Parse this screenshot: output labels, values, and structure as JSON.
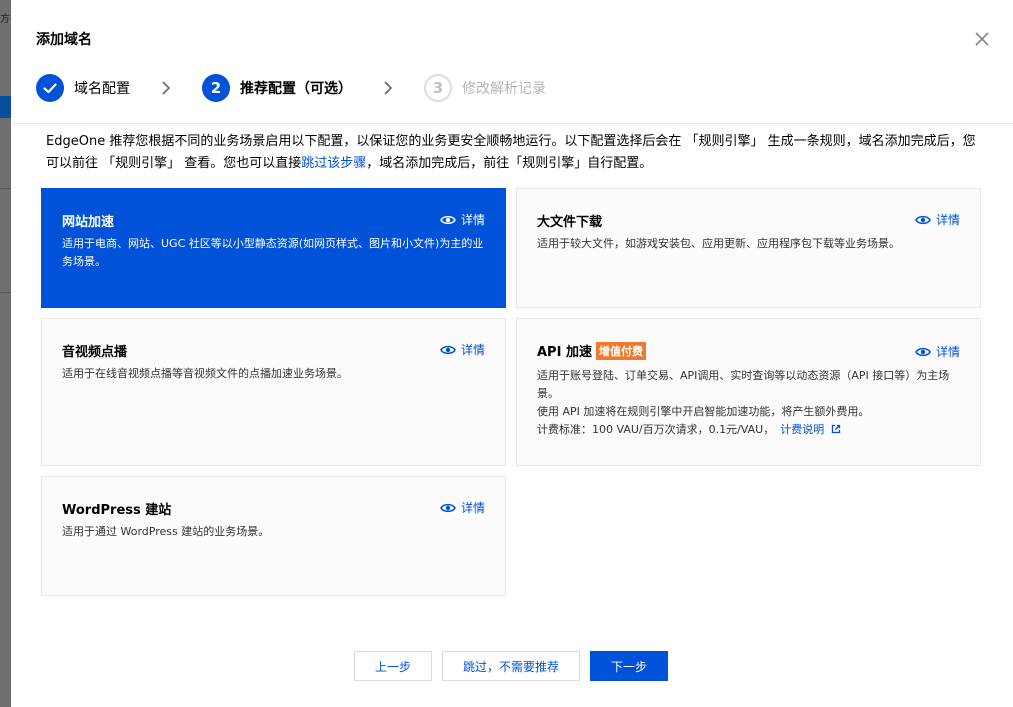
{
  "background": {
    "fragment": "方"
  },
  "modal": {
    "title": "添加域名"
  },
  "steps": [
    {
      "number": "1",
      "label": "域名配置",
      "state": "done"
    },
    {
      "number": "2",
      "label": "推荐配置（可选）",
      "state": "active"
    },
    {
      "number": "3",
      "label": "修改解析记录",
      "state": "pending"
    }
  ],
  "intro": {
    "text1": "EdgeOne 推荐您根据不同的业务场景启用以下配置，以保证您的业务更安全顺畅地运行。以下配置选择后会在 「规则引擎」 生成一条规则，域名添加完成后，您可以前往 「规则引擎」 查看。您也可以直接",
    "link": "跳过该步骤",
    "text2": "，域名添加完成后，前往「规则引擎」自行配置。"
  },
  "cards": [
    {
      "title": "网站加速",
      "detail": "详情",
      "desc": "适用于电商、网站、UGC 社区等以小型静态资源(如网页样式、图片和小文件)为主的业务场景。",
      "selected": true
    },
    {
      "title": "大文件下载",
      "detail": "详情",
      "desc": "适用于较大文件，如游戏安装包、应用更新、应用程序包下载等业务场景。",
      "selected": false
    },
    {
      "title": "音视频点播",
      "detail": "详情",
      "desc": "适用于在线音视频点播等音视频文件的点播加速业务场景。",
      "selected": false
    },
    {
      "title": "API 加速",
      "badge": "增值付费",
      "detail": "详情",
      "desc": "适用于账号登陆、订单交易、API调用、实时查询等以动态资源（API 接口等）为主场景。",
      "extra1": "使用 API 加速将在规则引擎中开启智能加速功能，将产生额外费用。",
      "extra2": "计费标准：100 VAU/百万次请求，0.1元/VAU，",
      "extra_link": "计费说明",
      "selected": false
    },
    {
      "title": "WordPress 建站",
      "detail": "详情",
      "desc": "适用于通过 WordPress 建站的业务场景。",
      "selected": false
    }
  ],
  "footer": {
    "prev": "上一步",
    "skip": "跳过，不需要推荐",
    "next": "下一步"
  },
  "colors": {
    "primary": "#0052d9",
    "badge": "#ed7b2f"
  }
}
